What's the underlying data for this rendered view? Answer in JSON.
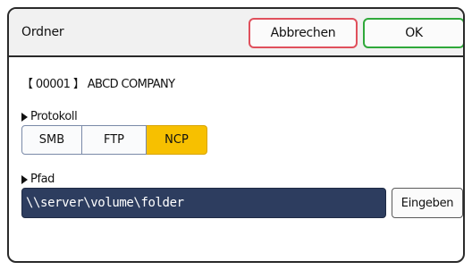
{
  "header": {
    "title": "Ordner",
    "cancel_label": "Abbrechen",
    "ok_label": "OK"
  },
  "destination": {
    "name": "【 00001 】 ABCD COMPANY"
  },
  "protocol": {
    "label": "Protokoll",
    "options": [
      "SMB",
      "FTP",
      "NCP"
    ],
    "selected": "NCP"
  },
  "path": {
    "label": "Pfad",
    "value": "\\\\server\\volume\\folder",
    "enter_label": "Eingeben"
  },
  "colors": {
    "accent_selected": "#f7c000",
    "cancel_border": "#e0505c",
    "ok_border": "#2fa83a",
    "field_bg": "#2d3d5f"
  }
}
